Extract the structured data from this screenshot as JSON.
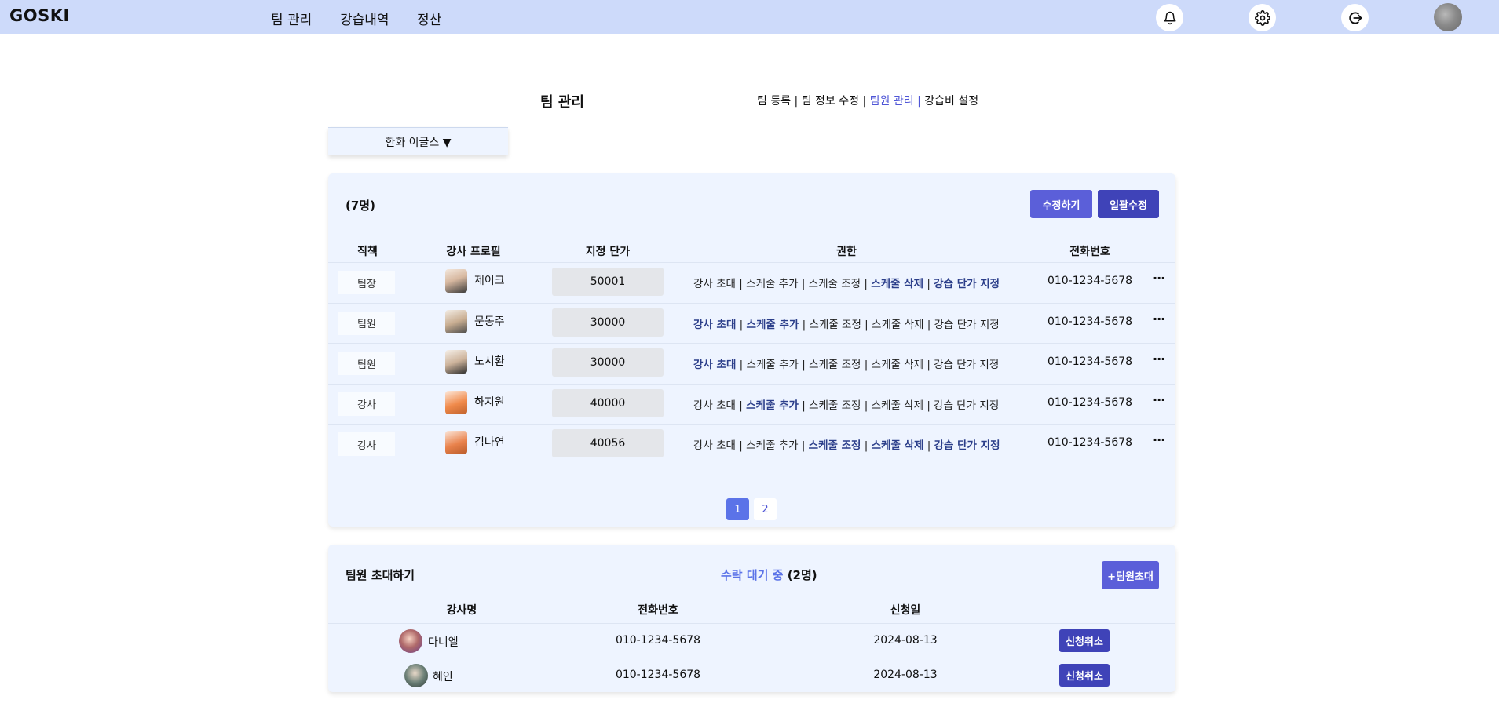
{
  "app": {
    "logo": "GOSKI"
  },
  "nav": {
    "items": [
      "팀 관리",
      "강습내역",
      "정산"
    ]
  },
  "header_icons": [
    "bell-icon",
    "gear-icon",
    "logout-icon"
  ],
  "page": {
    "title": "팀 관리",
    "subnav": [
      "팀 등록",
      "팀 정보 수정",
      "팀원 관리",
      "강습비 설정"
    ],
    "subnav_active": "팀원 관리",
    "subnav_sep": "|"
  },
  "team_select": {
    "value": "한화 이글스 ▼"
  },
  "members": {
    "count": "(7명)",
    "edit_label": "수정하기",
    "bulk_label": "일괄수정",
    "columns": [
      "직책",
      "강사 프로필",
      "지정 단가",
      "권한",
      "전화번호"
    ],
    "rows": [
      {
        "role": "팀장",
        "name": "제이크",
        "price": "50001",
        "perms": [
          [
            "강사 초대",
            false
          ],
          [
            "스케줄 추가",
            false
          ],
          [
            "스케줄 조정",
            false
          ],
          [
            "스케줄 삭제",
            true
          ],
          [
            "강습 단가 지정",
            true
          ]
        ],
        "phone": "010-1234-5678"
      },
      {
        "role": "팀원",
        "name": "문동주",
        "price": "30000",
        "perms": [
          [
            "강사 초대",
            true
          ],
          [
            "스케줄 추가",
            true
          ],
          [
            "스케줄 조정",
            false
          ],
          [
            "스케줄 삭제",
            false
          ],
          [
            "강습 단가 지정",
            false
          ]
        ],
        "phone": "010-1234-5678"
      },
      {
        "role": "팀원",
        "name": "노시환",
        "price": "30000",
        "perms": [
          [
            "강사 초대",
            true
          ],
          [
            "스케줄 추가",
            false
          ],
          [
            "스케줄 조정",
            false
          ],
          [
            "스케줄 삭제",
            false
          ],
          [
            "강습 단가 지정",
            false
          ]
        ],
        "phone": "010-1234-5678"
      },
      {
        "role": "강사",
        "name": "하지원",
        "price": "40000",
        "perms": [
          [
            "강사 초대",
            false
          ],
          [
            "스케줄 추가",
            true
          ],
          [
            "스케줄 조정",
            false
          ],
          [
            "스케줄 삭제",
            false
          ],
          [
            "강습 단가 지정",
            false
          ]
        ],
        "phone": "010-1234-5678"
      },
      {
        "role": "강사",
        "name": "김나연",
        "price": "40056",
        "perms": [
          [
            "강사 초대",
            false
          ],
          [
            "스케줄 추가",
            false
          ],
          [
            "스케줄 조정",
            true
          ],
          [
            "스케줄 삭제",
            true
          ],
          [
            "강습 단가 지정",
            true
          ]
        ],
        "phone": "010-1234-5678"
      }
    ],
    "more_label": "···",
    "pages": [
      "1",
      "2"
    ],
    "current_page": "1"
  },
  "invite": {
    "title": "팀원 초대하기",
    "pending_label": "수락 대기 중",
    "pending_count": "(2명)",
    "invite_button": "+팀원초대",
    "columns": [
      "강사명",
      "전화번호",
      "신청일"
    ],
    "rows": [
      {
        "name": "다니엘",
        "phone": "010-1234-5678",
        "date": "2024-08-13",
        "action": "신청취소"
      },
      {
        "name": "혜인",
        "phone": "010-1234-5678",
        "date": "2024-08-13",
        "action": "신청취소"
      }
    ]
  },
  "colors": {
    "topbar": "#cddafa",
    "panel": "#eef4ff",
    "primary": "#5b5fd9",
    "primary_dark": "#3f43b8",
    "accent_text": "#5b73e8"
  }
}
